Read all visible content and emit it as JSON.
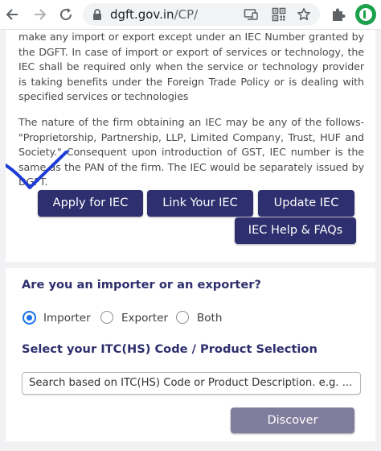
{
  "browser": {
    "url_domain": "dgft.gov.in",
    "url_path": "/CP/",
    "icons": [
      "back-arrow-icon",
      "forward-arrow-icon",
      "reload-icon",
      "lock-icon",
      "install-app-icon",
      "qr-code-icon",
      "star-icon",
      "puzzle-extension-icon",
      "green-extension-icon"
    ]
  },
  "iec_info": {
    "paragraph1": "make any import or export except under an IEC Number granted by the DGFT. In case of import or export of services or technology, the IEC shall be required only when the service or technology provider is taking benefits under the Foreign Trade Policy or is dealing with specified services or technologies",
    "paragraph2": "The nature of the firm obtaining an IEC may be any of the follows- \"Proprietorship, Partnership, LLP, Limited Company, Trust, HUF and Society.\" Consequent upon introduction of GST, IEC number is the same as the PAN of the firm. The IEC would be separately issued by DGFT.",
    "buttons": {
      "apply": "Apply for IEC",
      "link": "Link Your IEC",
      "update": "Update IEC",
      "help": "IEC Help & FAQs"
    }
  },
  "trade_search": {
    "question": "Are you an importer or an exporter?",
    "options": [
      {
        "label": "Importer",
        "selected": true
      },
      {
        "label": "Exporter",
        "selected": false
      },
      {
        "label": "Both",
        "selected": false
      }
    ],
    "select_title": "Select your ITC(HS) Code / Product Selection",
    "search_placeholder": "Search based on ITC(HS) Code or Product Description. e.g. ...",
    "discover_label": "Discover"
  },
  "colors": {
    "primary_button": "#2e2f6e",
    "disabled_button": "#7f7c9c",
    "heading": "#2e2f6e",
    "radio_selected": "#1a73e8",
    "annotation_check": "#1f3dd6"
  }
}
